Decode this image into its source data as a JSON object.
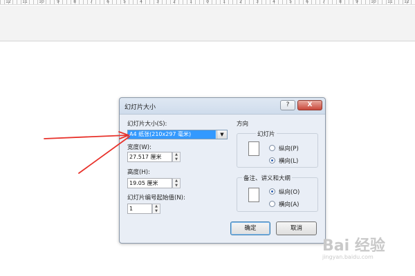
{
  "ruler": {
    "numbers": [
      "12",
      "11",
      "10",
      "9",
      "8",
      "7",
      "6",
      "5",
      "4",
      "3",
      "2",
      "1",
      "0",
      "1",
      "2",
      "3",
      "4",
      "5",
      "6",
      "7",
      "8",
      "9",
      "10",
      "11",
      "12"
    ]
  },
  "dialog": {
    "title": "幻灯片大小",
    "help_label": "?",
    "close_label": "X",
    "size_label": "幻灯片大小(S):",
    "size_value": "A4 纸张(210x297 毫米)",
    "width_label": "宽度(W):",
    "width_value": "27.517 厘米",
    "height_label": "高度(H):",
    "height_value": "19.05 厘米",
    "start_label": "幻灯片编号起始值(N):",
    "start_value": "1",
    "direction_label": "方向",
    "slides_group_label": "幻灯片",
    "slides_portrait": "纵向(P)",
    "slides_landscape": "横向(L)",
    "notes_group_label": "备注、讲义和大纲",
    "notes_portrait": "纵向(O)",
    "notes_landscape": "横向(A)",
    "ok_label": "确定",
    "cancel_label": "取消",
    "selected": {
      "slides": "landscape",
      "notes": "portrait"
    }
  },
  "watermark": {
    "brand": "Bai 经验",
    "url": "jingyan.baidu.com"
  },
  "colors": {
    "selection": "#3399ff",
    "annotation_arrow": "#e8312a"
  }
}
